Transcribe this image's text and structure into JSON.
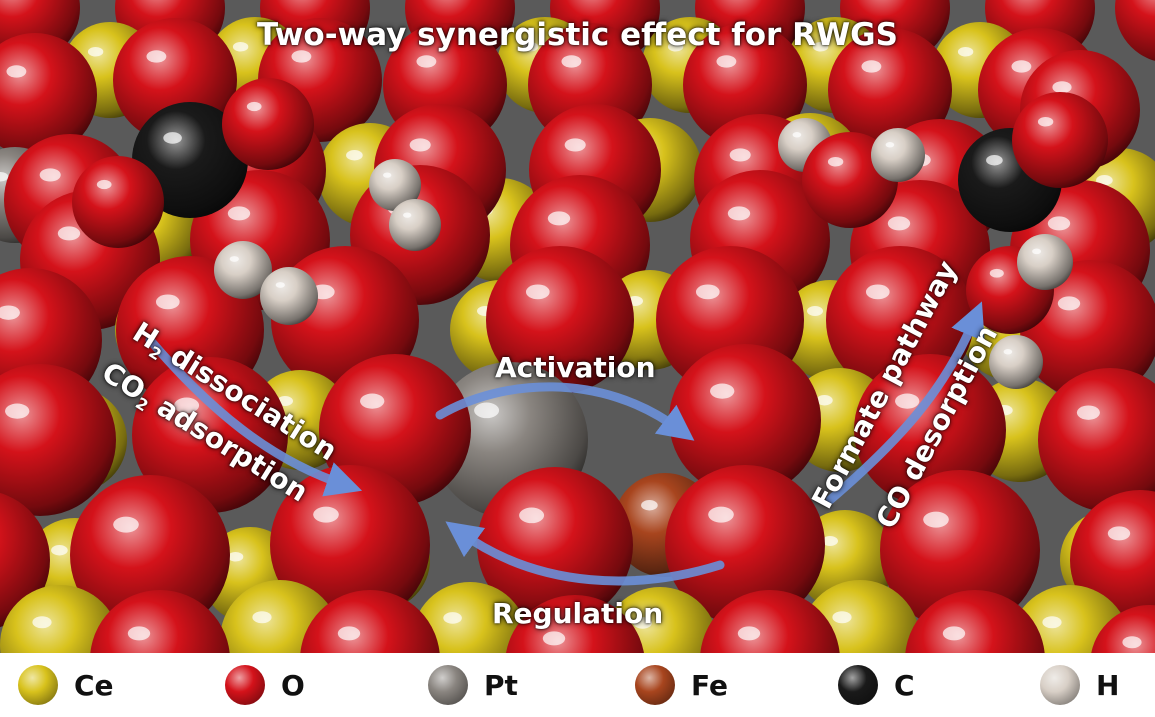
{
  "title": "Two-way synergistic effect for RWGS",
  "labels": {
    "h2_main": "H",
    "h2_sub": "2",
    "h2_rest": " dissociation",
    "co2_main": "CO",
    "co2_sub": "2",
    "co2_rest": " adsorption",
    "activation": "Activation",
    "regulation": "Regulation",
    "formate": "Formate pathway",
    "co_desorption": "CO desorption"
  },
  "legend": [
    {
      "name": "Ce",
      "color": "#d8c21c"
    },
    {
      "name": "O",
      "color": "#d4121a"
    },
    {
      "name": "Pt",
      "color": "#8a8580"
    },
    {
      "name": "Fe",
      "color": "#a8451e"
    },
    {
      "name": "C",
      "color": "#1a1a1a"
    },
    {
      "name": "H",
      "color": "#d8cfc6"
    }
  ],
  "colors": {
    "Ce": "#d8c21c",
    "O": "#d4121a",
    "Pt": "#8a8580",
    "Fe": "#a8451e",
    "C": "#1a1a1a",
    "H": "#d8cfc6",
    "arrow": "#6a8fd8"
  }
}
